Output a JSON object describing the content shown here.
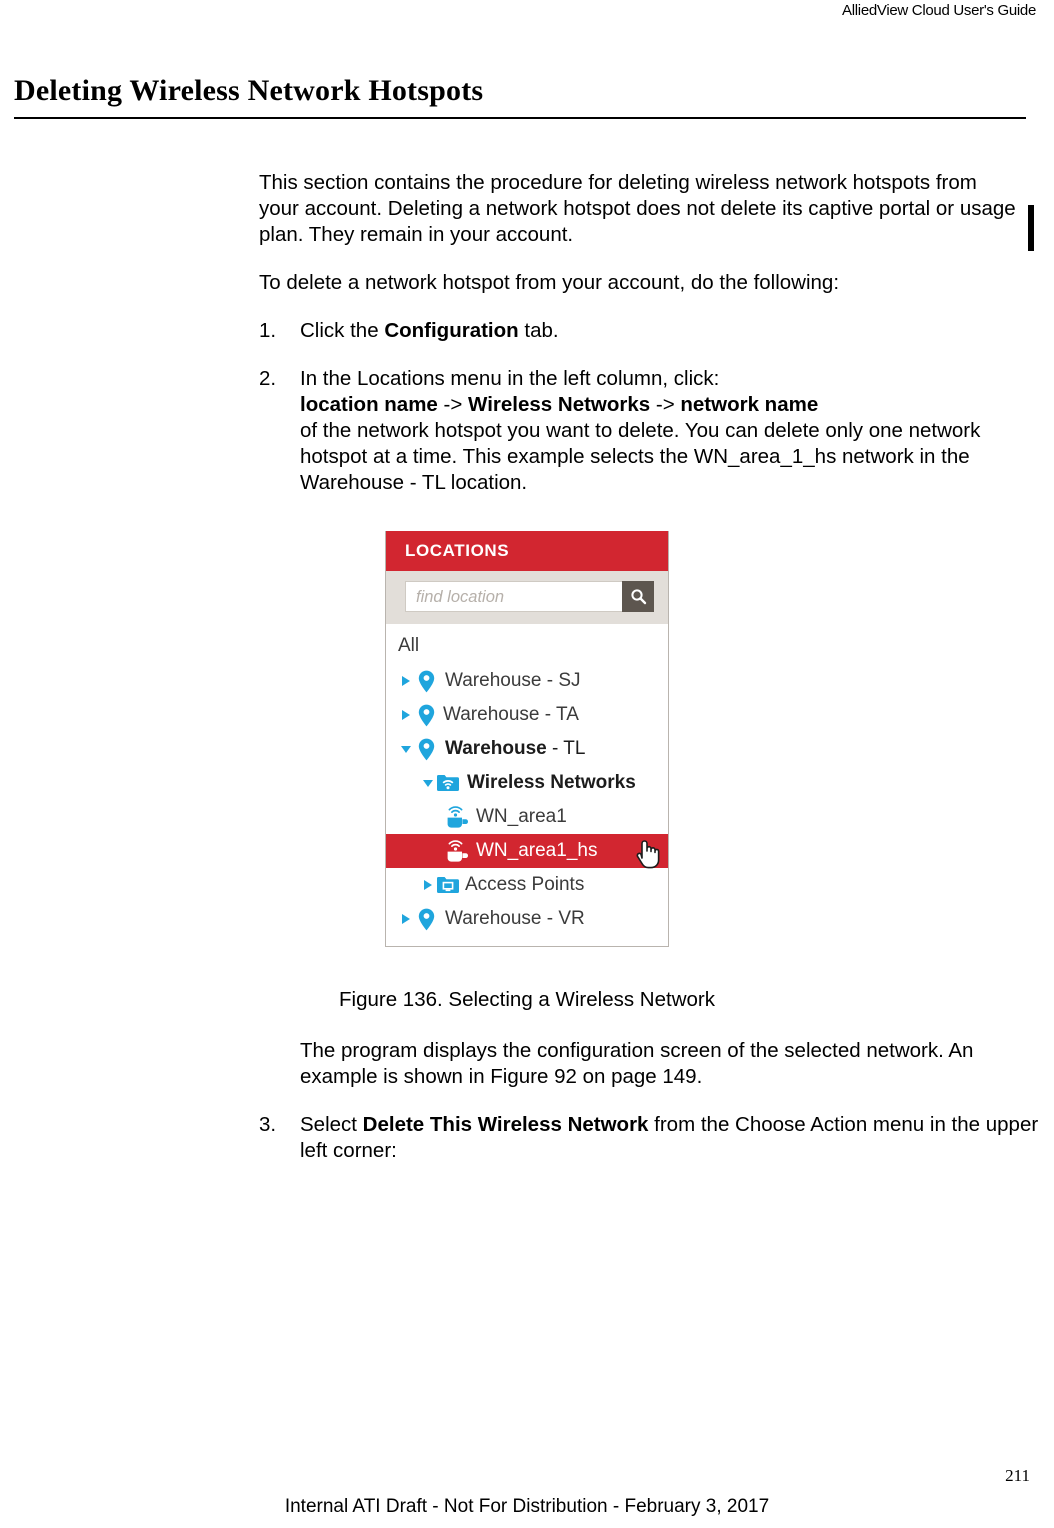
{
  "running_header": "AlliedView Cloud User's Guide",
  "section_title": "Deleting Wireless Network Hotspots",
  "intro": {
    "paragraph_1": "This section contains the procedure for deleting wireless network hotspots from your account. Deleting a network hotspot does not delete its captive portal or usage plan. They remain in your account.",
    "paragraph_2": "To delete a network hotspot from your account, do the following:"
  },
  "steps": [
    {
      "number": "1.",
      "text_before": "Click the ",
      "bold": "Configuration",
      "text_after": " tab."
    },
    {
      "number": "2.",
      "line_1": "In the Locations menu in the left column, click:",
      "path_bold_1": "location name",
      "path_sep_1": " -> ",
      "path_bold_2": "Wireless Networks",
      "path_sep_2": " -> ",
      "path_bold_3": "network name",
      "line_3": "of the network hotspot you want to delete. You can delete only one network hotspot at a time. This example selects the WN_area_1_hs network in the Warehouse - TL location."
    },
    {
      "number": "3.",
      "text_before": "Select ",
      "bold": "Delete This Wireless Network",
      "text_after": " from the Choose Action menu in the upper left corner:"
    }
  ],
  "figure": {
    "caption": "Figure 136. Selecting a Wireless Network",
    "panel": {
      "header_title": "LOCATIONS",
      "search_placeholder": "find location",
      "search_icon": "search-icon",
      "root_label": "All",
      "tree": [
        {
          "label": "Warehouse - SJ",
          "indent": 0,
          "arrow": "collapsed",
          "icon": "map-pin-icon",
          "bold": false,
          "selected": false
        },
        {
          "label": "Warehouse - TA",
          "indent": 0,
          "arrow": "collapsed",
          "icon": "map-pin-icon",
          "bold": false,
          "selected": false
        },
        {
          "label_bold": "Warehouse",
          "label_rest": " - TL",
          "indent": 0,
          "arrow": "expanded",
          "icon": "map-pin-icon",
          "bold": true,
          "selected": false
        },
        {
          "label": "Wireless Networks",
          "indent": 1,
          "arrow": "expanded",
          "icon": "wifi-folder-icon",
          "bold": true,
          "selected": false
        },
        {
          "label": "WN_area1",
          "indent": 2,
          "arrow": "none",
          "icon": "hotspot-cup-icon",
          "bold": false,
          "selected": false
        },
        {
          "label": "WN_area1_hs",
          "indent": 2,
          "arrow": "none",
          "icon": "hotspot-cup-icon",
          "bold": false,
          "selected": true
        },
        {
          "label": "Access Points",
          "indent": 1,
          "arrow": "collapsed",
          "icon": "access-point-folder-icon",
          "bold": false,
          "selected": false
        },
        {
          "label": "Warehouse - VR",
          "indent": 0,
          "arrow": "collapsed",
          "icon": "map-pin-icon",
          "bold": false,
          "selected": false
        }
      ],
      "cursor": "hand-pointer-cursor"
    }
  },
  "after_figure": {
    "paragraph": "The program displays the configuration screen of the selected network. An example is shown in Figure 92 on page 149."
  },
  "footer": {
    "page_number": "211",
    "note": "Internal ATI Draft - Not For Distribution - February 3, 2017"
  },
  "colors": {
    "brand_red": "#d22630",
    "icon_blue": "#1fa5dd",
    "search_bar_bg": "#e2ded9",
    "search_button": "#5d564f",
    "panel_border": "#b9b4ae"
  }
}
